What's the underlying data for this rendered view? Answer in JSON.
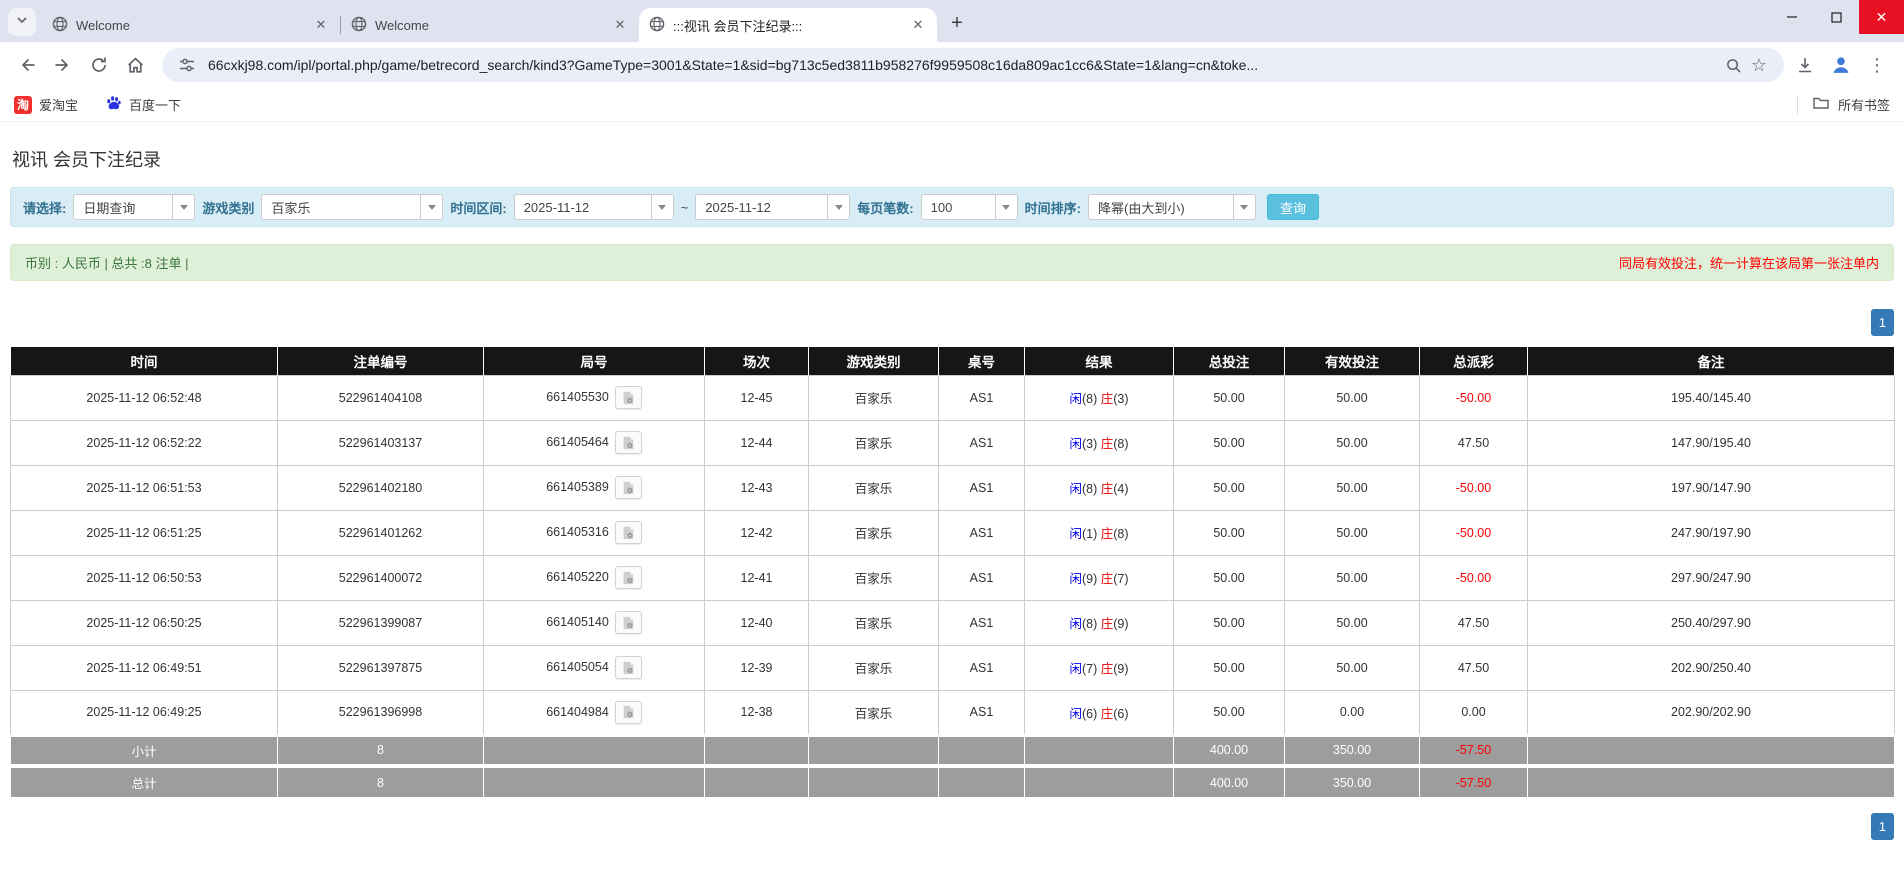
{
  "colors": {
    "accent_blue": "#337ab7",
    "link_blue": "#0667d0",
    "player_blue": "#0000ee",
    "banker_red": "#e50000",
    "negative_red": "#ff0000",
    "filter_bar_bg": "#d9edf7",
    "info_bar_bg": "#dff0d8",
    "table_header_bg": "#161616",
    "totals_row_bg": "#9d9d9d",
    "query_button_bg": "#5bc0de",
    "close_button_red": "#e81123"
  },
  "browser": {
    "tabs": [
      {
        "title": "Welcome"
      },
      {
        "title": "Welcome"
      },
      {
        "title": ":::视讯 会员下注纪录:::"
      }
    ],
    "url": "66cxkj98.com/ipl/portal.php/game/betrecord_search/kind3?GameType=3001&State=1&sid=bg713c5ed3811b958276f9959508c16da809ac1cc6&State=1&lang=cn&toke...",
    "bookmarks": [
      {
        "label": "爱淘宝",
        "icon": "taobao-icon"
      },
      {
        "label": "百度一下",
        "icon": "baidu-paw-icon"
      }
    ],
    "all_bookmarks_label": "所有书签"
  },
  "page": {
    "title": "视讯 会员下注纪录",
    "filters": {
      "select_label": "请选择:",
      "select_value": "日期查询",
      "game_type_label": "游戏类别",
      "game_type_value": "百家乐",
      "date_range_label": "时间区间:",
      "date_from": "2025-11-12",
      "date_to": "2025-11-12",
      "range_separator": "~",
      "page_size_label": "每页笔数:",
      "page_size_value": "100",
      "sort_label": "时间排序:",
      "sort_value": "降幂(由大到小)",
      "query_button": "查询"
    },
    "info_bar": {
      "left": "币别 : 人民币 | 总共 :8 注单 |",
      "right": "同局有效投注，统一计算在该局第一张注单内"
    },
    "pagination": {
      "current": "1"
    },
    "table": {
      "headers": [
        "时间",
        "注单编号",
        "局号",
        "场次",
        "游戏类别",
        "桌号",
        "结果",
        "总投注",
        "有效投注",
        "总派彩",
        "备注"
      ],
      "rows": [
        {
          "time": "2025-11-12 06:52:48",
          "bet_id": "522961404108",
          "round_id": "661405530",
          "session": "12-45",
          "game": "百家乐",
          "table_no": "AS1",
          "result_player": "闲",
          "result_player_num": "(8)",
          "result_banker": "庄",
          "result_banker_num": "(3)",
          "total_bet": "50.00",
          "valid_bet": "50.00",
          "payout": "-50.00",
          "remark": "195.40/145.40"
        },
        {
          "time": "2025-11-12 06:52:22",
          "bet_id": "522961403137",
          "round_id": "661405464",
          "session": "12-44",
          "game": "百家乐",
          "table_no": "AS1",
          "result_player": "闲",
          "result_player_num": "(3)",
          "result_banker": "庄",
          "result_banker_num": "(8)",
          "total_bet": "50.00",
          "valid_bet": "50.00",
          "payout": "47.50",
          "remark": "147.90/195.40"
        },
        {
          "time": "2025-11-12 06:51:53",
          "bet_id": "522961402180",
          "round_id": "661405389",
          "session": "12-43",
          "game": "百家乐",
          "table_no": "AS1",
          "result_player": "闲",
          "result_player_num": "(8)",
          "result_banker": "庄",
          "result_banker_num": "(4)",
          "total_bet": "50.00",
          "valid_bet": "50.00",
          "payout": "-50.00",
          "remark": "197.90/147.90"
        },
        {
          "time": "2025-11-12 06:51:25",
          "bet_id": "522961401262",
          "round_id": "661405316",
          "session": "12-42",
          "game": "百家乐",
          "table_no": "AS1",
          "result_player": "闲",
          "result_player_num": "(1)",
          "result_banker": "庄",
          "result_banker_num": "(8)",
          "total_bet": "50.00",
          "valid_bet": "50.00",
          "payout": "-50.00",
          "remark": "247.90/197.90"
        },
        {
          "time": "2025-11-12 06:50:53",
          "bet_id": "522961400072",
          "round_id": "661405220",
          "session": "12-41",
          "game": "百家乐",
          "table_no": "AS1",
          "result_player": "闲",
          "result_player_num": "(9)",
          "result_banker": "庄",
          "result_banker_num": "(7)",
          "total_bet": "50.00",
          "valid_bet": "50.00",
          "payout": "-50.00",
          "remark": "297.90/247.90"
        },
        {
          "time": "2025-11-12 06:50:25",
          "bet_id": "522961399087",
          "round_id": "661405140",
          "session": "12-40",
          "game": "百家乐",
          "table_no": "AS1",
          "result_player": "闲",
          "result_player_num": "(8)",
          "result_banker": "庄",
          "result_banker_num": "(9)",
          "total_bet": "50.00",
          "valid_bet": "50.00",
          "payout": "47.50",
          "remark": "250.40/297.90"
        },
        {
          "time": "2025-11-12 06:49:51",
          "bet_id": "522961397875",
          "round_id": "661405054",
          "session": "12-39",
          "game": "百家乐",
          "table_no": "AS1",
          "result_player": "闲",
          "result_player_num": "(7)",
          "result_banker": "庄",
          "result_banker_num": "(9)",
          "total_bet": "50.00",
          "valid_bet": "50.00",
          "payout": "47.50",
          "remark": "202.90/250.40"
        },
        {
          "time": "2025-11-12 06:49:25",
          "bet_id": "522961396998",
          "round_id": "661404984",
          "session": "12-38",
          "game": "百家乐",
          "table_no": "AS1",
          "result_player": "闲",
          "result_player_num": "(6)",
          "result_banker": "庄",
          "result_banker_num": "(6)",
          "total_bet": "50.00",
          "valid_bet": "0.00",
          "payout": "0.00",
          "remark": "202.90/202.90"
        }
      ],
      "subtotal": {
        "label": "小计",
        "count": "8",
        "total_bet": "400.00",
        "valid_bet": "350.00",
        "payout": "-57.50"
      },
      "total": {
        "label": "总计",
        "count": "8",
        "total_bet": "400.00",
        "valid_bet": "350.00",
        "payout": "-57.50"
      }
    }
  }
}
